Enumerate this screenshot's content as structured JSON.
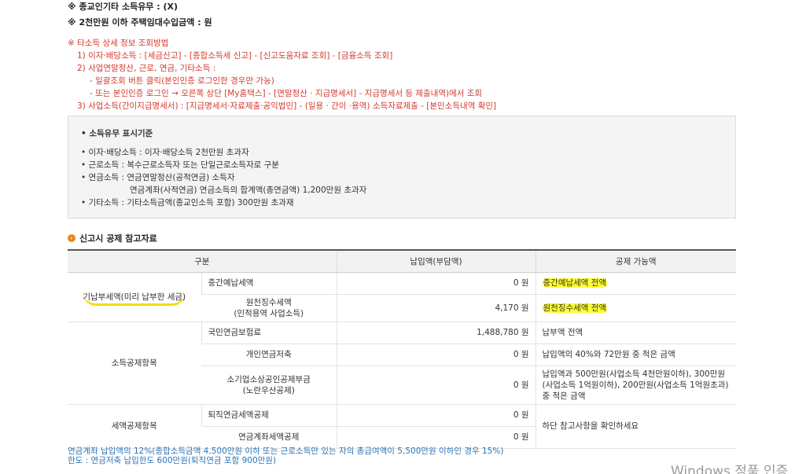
{
  "header_lines": {
    "religious_income": "※ 종교인기타 소득유무 : (X)",
    "housing_rent": "※ 2천만원 이하 주택임대수입금액 : 원"
  },
  "other_income_ref": {
    "title": "※ 타소득 상세 정보 조회방법",
    "item1": "1) 이자·배당소득 : [세금신고] - [종합소득세 신고] - [신고도움자료 조회] - [금융소득 조회]",
    "item2": "2) 사업연말정산, 근로, 연금, 기타소득 :",
    "item2a": "- 일괄조회 버튼 클릭(본인인증 로그인한 경우만 가능)",
    "item2b": "- 또는 본인인증 로그인 → 오른쪽 상단 [My홈택스] - [연말정산 · 지급명세서] - 지급명세서 등 제출내역)에서 조회",
    "item3": "3) 사업소득(간이지급명세서) : [지급명세서·자료제출·공익법인] - (일용 · 간이 ·용역) 소득자료제출 - [본인소득내역 확인]"
  },
  "criteria": {
    "title": "• 소득유무 표시기준",
    "items": [
      "• 이자·배당소득 : 이자·배당소득 2천만원 초과자",
      "• 근로소득 : 복수근로소득자 또는 단일근로소득자로 구분",
      "• 연금소득 : 연금연말정산(공적연금) 소득자",
      "연금계좌(사적연금) 연금소득의 합계액(총연금액) 1,200만원 초과자",
      "• 기타소득 : 기타소득금액(종교인소득 포함) 300만원 초과재"
    ]
  },
  "section_title": "신고시 공제 참고자료",
  "table": {
    "headers": [
      "구분",
      "납입액(부담액)",
      "공제 가능액"
    ],
    "group_prepaid": "기납부세액(미리 납부한 세금)",
    "group_income_deduction": "소득공제항목",
    "group_tax_credit": "세액공제항목",
    "rows": {
      "interim": {
        "name": "중간예납세액",
        "amount": "0 원",
        "deductible": "중간예납세액 전액"
      },
      "withholding": {
        "name": "원천징수세액",
        "name2": "(인적용역 사업소득)",
        "amount": "4,170 원",
        "deductible": "원천징수세액 전액"
      },
      "pension_ins": {
        "name": "국민연금보험료",
        "amount": "1,488,780 원",
        "deductible": "납부액 전액"
      },
      "personal_pension": {
        "name": "개인연금저축",
        "amount": "0 원",
        "deductible": "납입액의 40%와 72만원 중 적은 금액"
      },
      "small_biz": {
        "name": "소기업소상공인공제부금",
        "name2": "(노란우산공제)",
        "amount": "0 원",
        "deductible": "납입액과 500만원(사업소득 4천만원이하), 300만원(사업소득 1억원이하), 200만원(사업소득 1억원초과) 중 적은 금액"
      },
      "retire_pension": {
        "name": "퇴직연금세액공제",
        "amount": "0 원"
      },
      "pension_account": {
        "name": "연금계좌세액공제",
        "amount": "0 원"
      },
      "credit_note": "하단 참고사항을 확인하세요"
    }
  },
  "footnotes": {
    "line1": "연금계좌 납입액의 12%(종합소득금액 4,500만원 이하 또는 근로소득만 있는 자의 총급여액이 5,500만원 이하인 경우 15%)",
    "line2": "한도 : 연금저축 납입한도 600만원(퇴직연금 포함 900만원)"
  },
  "watermark": "Windows 정품 인증",
  "colors": {
    "red_text": "#d33a2c",
    "blue_note": "#2b74b8",
    "highlight": "#ffff33",
    "section_bullet": "#e38a1c"
  }
}
